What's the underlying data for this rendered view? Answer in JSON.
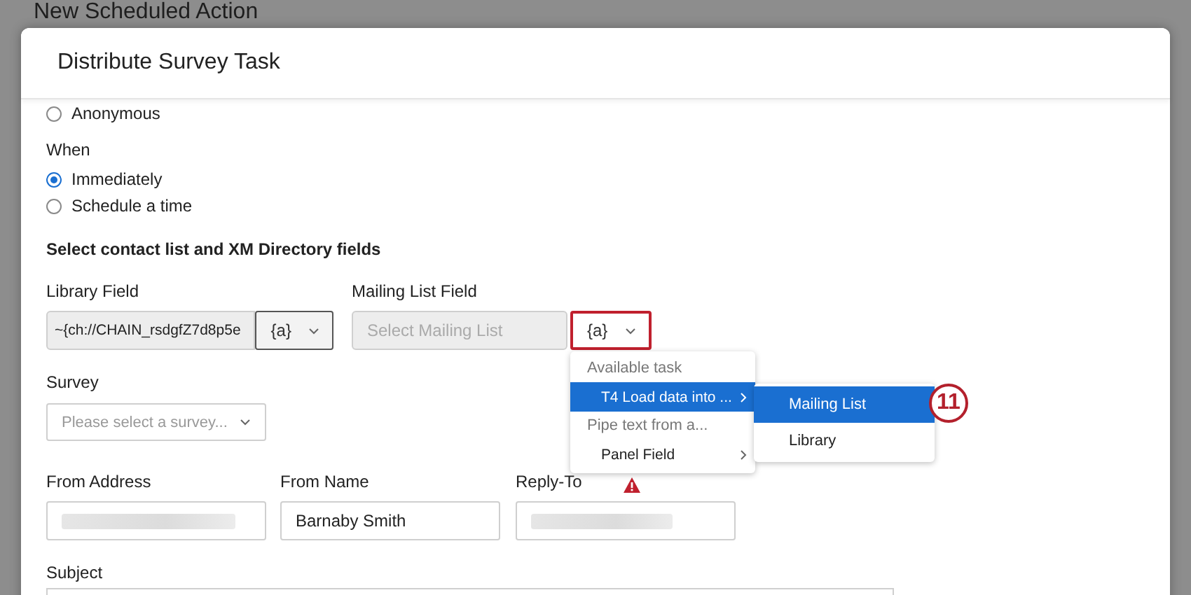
{
  "page_title": "New Scheduled Action",
  "dialog": {
    "title": "Distribute Survey Task"
  },
  "identity_option": {
    "label": "Anonymous",
    "selected": false
  },
  "when": {
    "label": "When",
    "options": [
      {
        "label": "Immediately",
        "selected": true
      },
      {
        "label": "Schedule a time",
        "selected": false
      }
    ]
  },
  "contact_section": {
    "title": "Select contact list and XM Directory fields"
  },
  "library_field": {
    "label": "Library Field",
    "value": "~{ch://CHAIN_rsdgfZ7d8p5e",
    "piped_text_button": "{a}",
    "highlighted": false
  },
  "mailing_list_field": {
    "label": "Mailing List Field",
    "placeholder": "Select Mailing List",
    "disabled": true,
    "piped_text_button": "{a}",
    "highlighted": true
  },
  "survey": {
    "label": "Survey",
    "placeholder": "Please select a survey..."
  },
  "from_address": {
    "label": "From Address",
    "redacted": true
  },
  "from_name": {
    "label": "From Name",
    "value": "Barnaby Smith"
  },
  "reply_to": {
    "label": "Reply-To",
    "redacted": true,
    "warning": true
  },
  "subject": {
    "label": "Subject"
  },
  "piped_text_menu": {
    "items": [
      {
        "kind": "header",
        "label": "Available task"
      },
      {
        "kind": "item",
        "label": "T4 Load data into ...",
        "selected": true,
        "submenu": true
      },
      {
        "kind": "header",
        "label": "Pipe text from a..."
      },
      {
        "kind": "item",
        "label": "Panel Field",
        "selected": false,
        "submenu": true
      }
    ]
  },
  "submenu": {
    "items": [
      {
        "label": "Mailing List",
        "selected": true
      },
      {
        "label": "Library",
        "selected": false
      }
    ]
  },
  "step_badge": "11"
}
